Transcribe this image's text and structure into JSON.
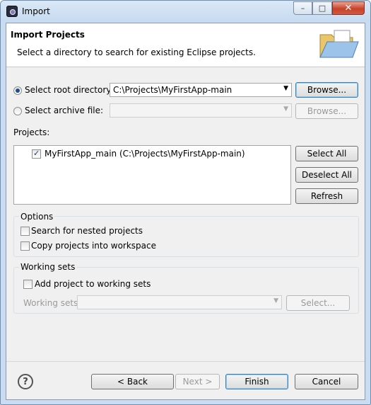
{
  "window": {
    "title": "Import"
  },
  "banner": {
    "title": "Import Projects",
    "description": "Select a directory to search for existing Eclipse projects."
  },
  "source": {
    "root_label": "Select root directory:",
    "root_selected": true,
    "root_value": "C:\\Projects\\MyFirstApp-main",
    "root_browse": "Browse...",
    "archive_label": "Select archive file:",
    "archive_selected": false,
    "archive_value": "",
    "archive_browse": "Browse..."
  },
  "projects": {
    "label": "Projects:",
    "items": [
      {
        "label": "MyFirstApp_main (C:\\Projects\\MyFirstApp-main)",
        "checked": true
      }
    ],
    "select_all": "Select All",
    "deselect_all": "Deselect All",
    "refresh": "Refresh"
  },
  "options": {
    "title": "Options",
    "nested": "Search for nested projects",
    "nested_checked": false,
    "copy": "Copy projects into workspace",
    "copy_checked": false
  },
  "working_sets": {
    "title": "Working sets",
    "add": "Add project to working sets",
    "add_checked": false,
    "label": "Working sets:",
    "value": "",
    "select": "Select..."
  },
  "footer": {
    "help": "?",
    "back": "< Back",
    "next": "Next >",
    "finish": "Finish",
    "cancel": "Cancel"
  },
  "colors": {
    "accent": "#3c7fb1",
    "titlebar": "#c6daf0",
    "dialog_bg": "#f0f0f0"
  }
}
